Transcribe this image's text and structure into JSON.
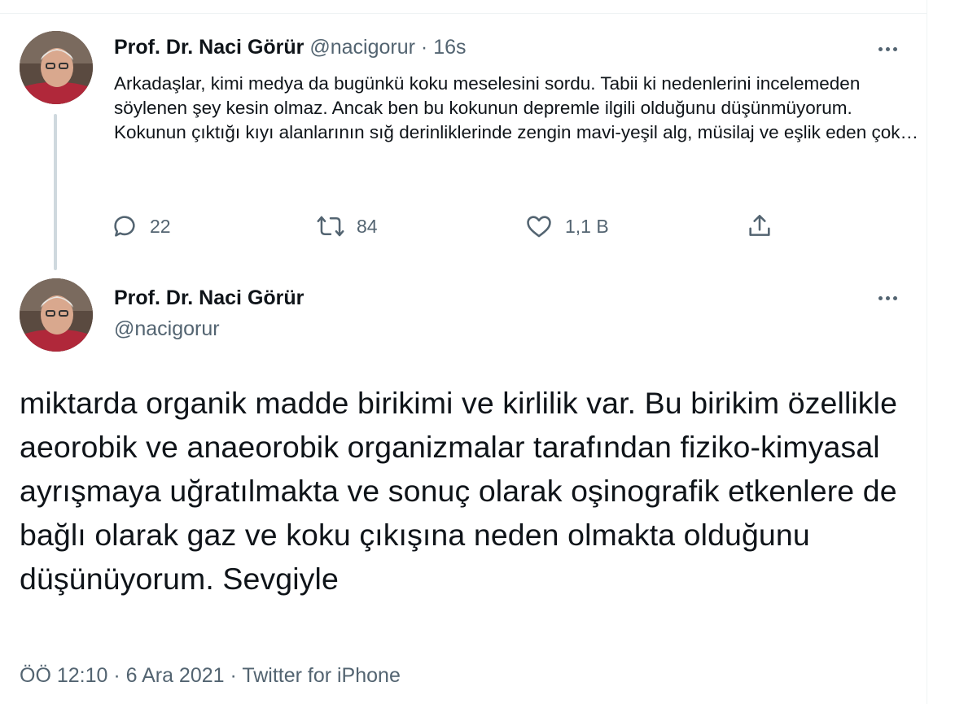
{
  "parent_tweet": {
    "author_name": "Prof. Dr. Naci Görür",
    "author_handle": "@nacigorur",
    "separator": "·",
    "time_ago": "16s",
    "text": "Arkadaşlar, kimi medya da bugünkü koku meselesini sordu. Tabii ki nedenlerini incelemeden söylenen şey kesin olmaz. Ancak ben bu kokunun depremle ilgili olduğunu düşünmüyorum. Kokunun çıktığı kıyı alanlarının sığ derinliklerinde zengin mavi-yeşil alg, müsilaj ve eşlik eden çok…",
    "actions": {
      "reply_count": "22",
      "retweet_count": "84",
      "like_count": "1,1 B"
    }
  },
  "main_tweet": {
    "author_name": "Prof. Dr. Naci Görür",
    "author_handle": "@nacigorur",
    "text": "miktarda organik madde birikimi ve kirlilik var. Bu birikim özellikle aeorobik ve anaeorobik organizmalar tarafından fiziko-kimyasal ayrışmaya uğratılmakta ve sonuç olarak oşinografik etkenlere de bağlı olarak gaz ve koku çıkışına neden olmakta olduğunu düşünüyorum. Sevgiyle",
    "meta": "ÖÖ 12:10 · 6 Ara 2021 · Twitter for iPhone"
  },
  "icons": {
    "more": "more-horizontal-icon",
    "reply": "reply-icon",
    "retweet": "retweet-icon",
    "like": "heart-icon",
    "share": "share-icon"
  },
  "colors": {
    "text_primary": "#0f1419",
    "text_secondary": "#536471",
    "thread_line": "#cfd9de",
    "divider": "#eff3f4"
  }
}
